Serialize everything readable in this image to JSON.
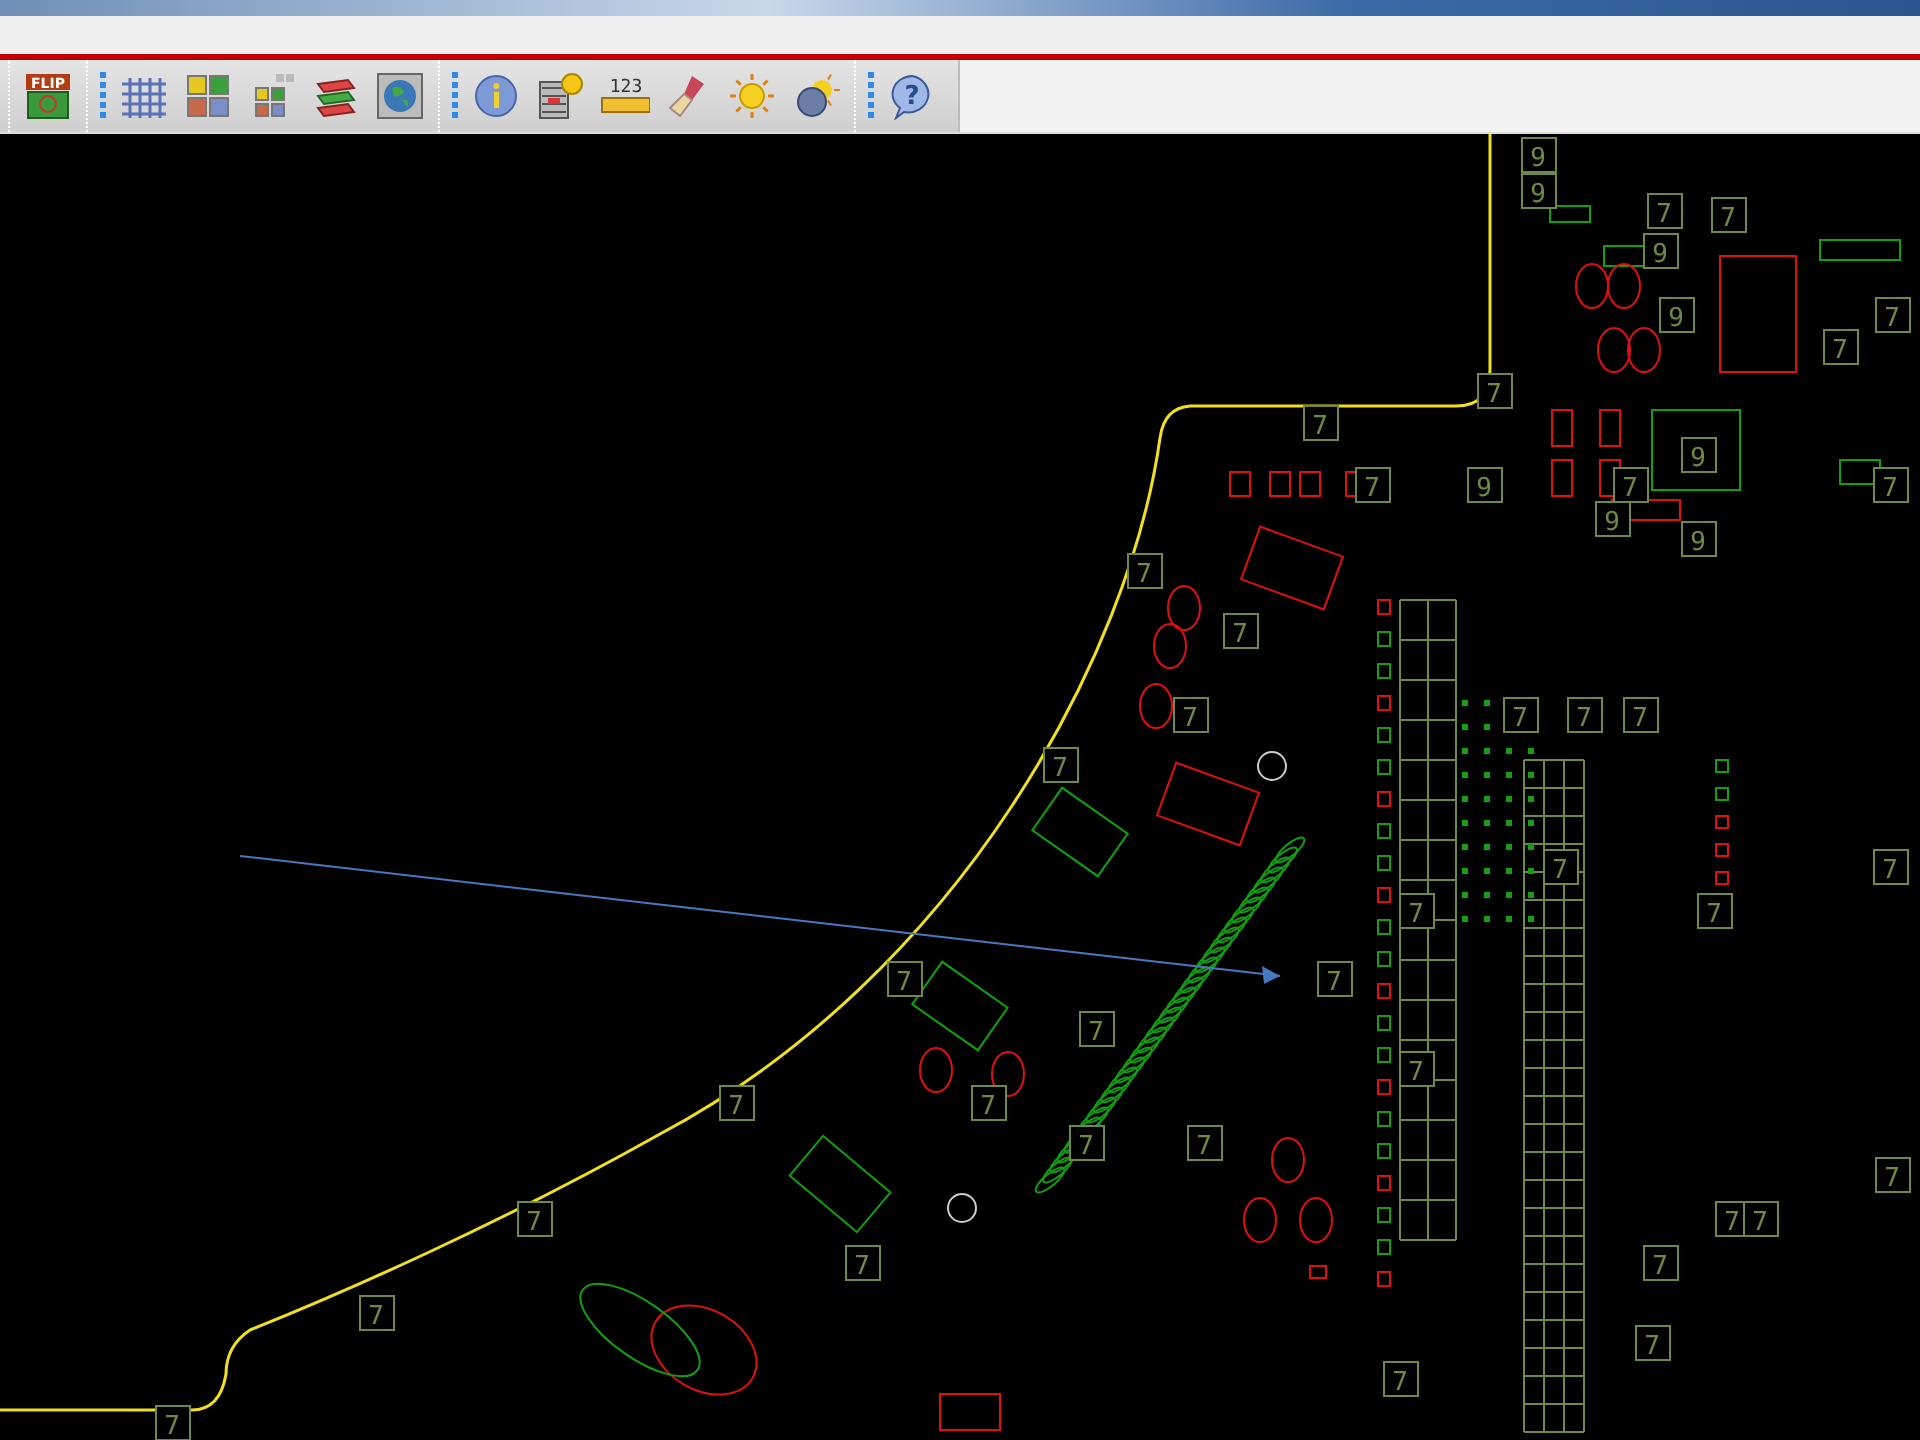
{
  "toolbar": {
    "groups": [
      {
        "buttons": [
          {
            "kind": "flip",
            "label": "FLIP"
          }
        ]
      },
      {
        "buttons": [
          {
            "kind": "grid"
          },
          {
            "kind": "parts"
          },
          {
            "kind": "parts-move"
          },
          {
            "kind": "layers"
          },
          {
            "kind": "globe"
          }
        ]
      },
      {
        "buttons": [
          {
            "kind": "info"
          },
          {
            "kind": "list-info"
          },
          {
            "kind": "ruler",
            "label": "123"
          },
          {
            "kind": "brush"
          },
          {
            "kind": "sun"
          },
          {
            "kind": "sun-dim"
          }
        ]
      },
      {
        "buttons": [
          {
            "kind": "help",
            "label": "?"
          }
        ]
      }
    ]
  },
  "board": {
    "pad_labels": [
      "9",
      "9",
      "7",
      "7",
      "9",
      "9",
      "7",
      "7",
      "7",
      "7",
      "9",
      "7",
      "9",
      "7",
      "7",
      "9",
      "9",
      "7",
      "7",
      "7",
      "7",
      "7",
      "7",
      "7",
      "7",
      "7",
      "7",
      "7",
      "7",
      "7",
      "7",
      "7",
      "7",
      "7",
      "7",
      "7",
      "7",
      "7",
      "7",
      "7",
      "7",
      "7",
      "7",
      "7",
      "7",
      "7"
    ]
  }
}
